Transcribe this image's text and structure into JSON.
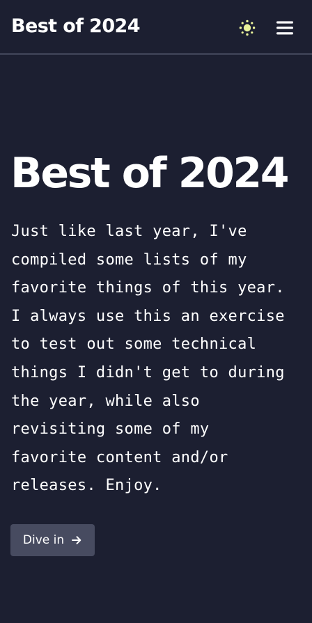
{
  "header": {
    "site_title": "Best of 2024",
    "theme_icon": "sun-icon",
    "theme_icon_color": "#eaf39a",
    "menu_icon": "hamburger-menu-icon"
  },
  "hero": {
    "heading": "Best of 2024",
    "body_lines": [
      "Just like last year, I've",
      "compiled some lists of my",
      "favorite things of this year.",
      "I always use this an exercise",
      "to test out some technical",
      "things I didn't get to during",
      "the year, while also",
      "revisiting some of my",
      "favorite content and/or",
      "releases. Enjoy."
    ],
    "cta_label": "Dive in",
    "cta_icon": "arrow-right-icon"
  },
  "colors": {
    "background": "#1c1f31",
    "header_border": "#3a3e52",
    "button_background": "#474b60",
    "text": "#ffffff"
  }
}
